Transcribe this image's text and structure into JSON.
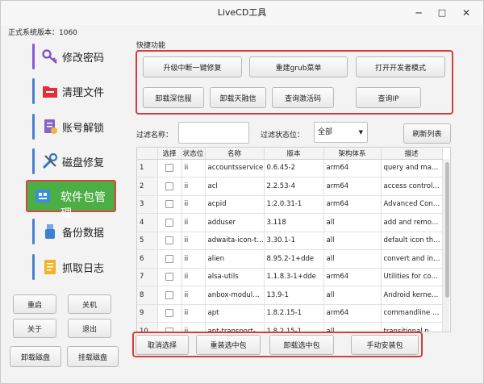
{
  "window": {
    "title": "LiveCD工具",
    "minimize_icon": "─",
    "maximize_icon": "□",
    "close_icon": "✕"
  },
  "sys_version": "正式系统版本：1060",
  "sidebar": {
    "items": [
      {
        "label": "修改密码",
        "icon": "key-icon",
        "color": "#7a4cc8"
      },
      {
        "label": "清理文件",
        "icon": "folder-clean-icon",
        "color": "#e0303e"
      },
      {
        "label": "账号解锁",
        "icon": "unlock-doc-icon",
        "color": "#8a63c8"
      },
      {
        "label": "磁盘修复",
        "icon": "tools-icon",
        "color": "#2a78c8"
      },
      {
        "label": "软件包管理",
        "icon": "package-icon",
        "color": "#3a8ee0",
        "active": true
      },
      {
        "label": "备份数据",
        "icon": "usb-icon",
        "color": "#3d7fd0"
      },
      {
        "label": "抓取日志",
        "icon": "log-doc-icon",
        "color": "#e0a020"
      }
    ],
    "buttons": {
      "reboot": "重启",
      "shutdown": "关机",
      "about": "关于",
      "exit": "退出",
      "unmount_disk": "卸载磁盘",
      "mount_disk": "挂载磁盘"
    }
  },
  "quick": {
    "title": "快捷功能",
    "buttons": [
      "升级中断一键修复",
      "重建grub菜单",
      "打开开发者模式",
      "卸载深信服",
      "卸载天融信",
      "查询激活码",
      "查询IP"
    ]
  },
  "filter": {
    "name_label": "过滤名称：",
    "name_value": "",
    "status_label": "过滤状态位：",
    "status_value": "全部",
    "refresh_label": "刷新列表"
  },
  "table": {
    "headers": [
      "选择",
      "状态位",
      "名称",
      "版本",
      "架构体系",
      "描述"
    ],
    "rows": [
      {
        "idx": "1",
        "status": "ii",
        "name": "accountsservice",
        "version": "0.6.45-2",
        "arch": "arm64",
        "desc": "query and ma…"
      },
      {
        "idx": "2",
        "status": "ii",
        "name": "acl",
        "version": "2.2.53-4",
        "arch": "arm64",
        "desc": "access control…"
      },
      {
        "idx": "3",
        "status": "ii",
        "name": "acpid",
        "version": "1:2.0.31-1",
        "arch": "arm64",
        "desc": "Advanced Con…"
      },
      {
        "idx": "4",
        "status": "ii",
        "name": "adduser",
        "version": "3.118",
        "arch": "all",
        "desc": "add and remo…"
      },
      {
        "idx": "5",
        "status": "ii",
        "name": "adwaita-icon-t…",
        "version": "3.30.1-1",
        "arch": "all",
        "desc": "default icon th…"
      },
      {
        "idx": "6",
        "status": "ii",
        "name": "alien",
        "version": "8.95.2-1+dde",
        "arch": "all",
        "desc": "convert and in…"
      },
      {
        "idx": "7",
        "status": "ii",
        "name": "alsa-utils",
        "version": "1.1.8.3-1+dde",
        "arch": "arm64",
        "desc": "Utilities for co…"
      },
      {
        "idx": "8",
        "status": "ii",
        "name": "anbox-modul…",
        "version": "13.9-1",
        "arch": "all",
        "desc": "Android kerne…"
      },
      {
        "idx": "9",
        "status": "ii",
        "name": "apt",
        "version": "1.8.2.15-1",
        "arch": "arm64",
        "desc": "commandline …"
      },
      {
        "idx": "10",
        "status": "ii",
        "name": "apt-transport-…",
        "version": "1.8.2.15-1",
        "arch": "all",
        "desc": "transitional p…"
      }
    ]
  },
  "bottom": {
    "buttons": [
      "取消选择",
      "重装选中包",
      "卸载选中包",
      "手动安装包"
    ]
  },
  "colors": {
    "highlight": "#d83b3b",
    "active_nav": "#4caf45"
  }
}
